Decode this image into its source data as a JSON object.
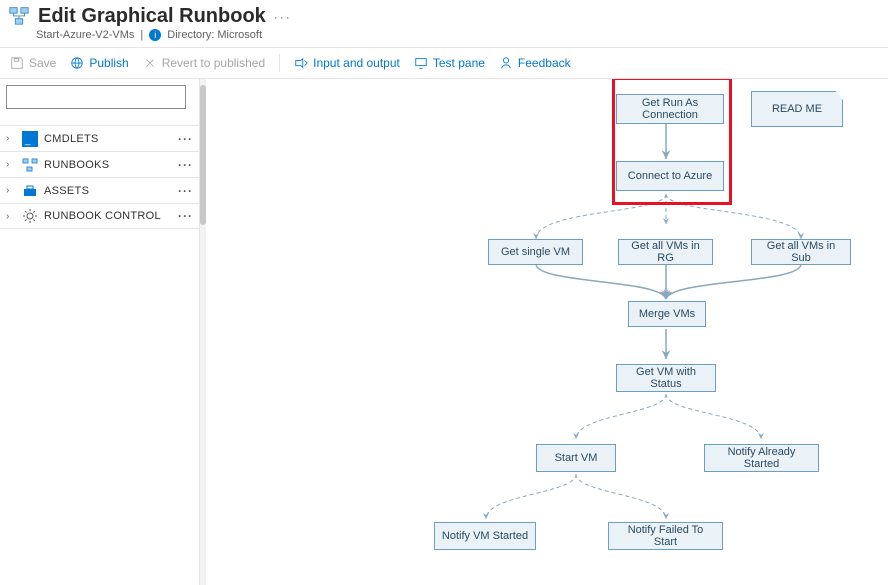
{
  "header": {
    "title": "Edit Graphical Runbook",
    "subtitle_left": "Start-Azure-V2-VMs",
    "subtitle_right": "Directory: Microsoft"
  },
  "toolbar": {
    "save": "Save",
    "publish": "Publish",
    "revert": "Revert to published",
    "io": "Input and output",
    "test": "Test pane",
    "feedback": "Feedback"
  },
  "searchPlaceholder": "",
  "library": {
    "items": [
      {
        "label": "CMDLETS",
        "icon": "ps-icon"
      },
      {
        "label": "RUNBOOKS",
        "icon": "runbook-icon"
      },
      {
        "label": "ASSETS",
        "icon": "toolbox-icon"
      },
      {
        "label": "RUNBOOK CONTROL",
        "icon": "gear-icon"
      }
    ]
  },
  "nodes": {
    "runAs": "Get Run As Connection",
    "connect": "Connect to Azure",
    "readme": "READ ME",
    "singleVM": "Get single VM",
    "allRG": "Get all VMs in RG",
    "allSub": "Get all VMs in Sub",
    "merge": "Merge VMs",
    "status": "Get VM with Status",
    "start": "Start VM",
    "already": "Notify Already Started",
    "started": "Notify VM Started",
    "failed": "Notify Failed To Start"
  }
}
